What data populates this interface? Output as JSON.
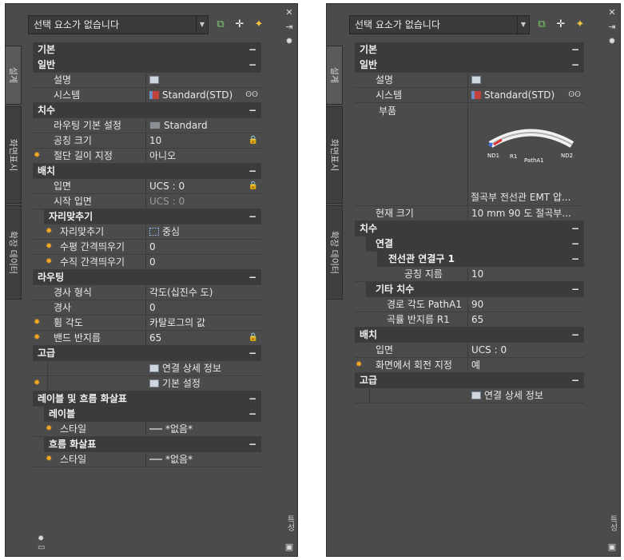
{
  "panel_left": {
    "selection": "선택 요소가 없습니다",
    "tabs": [
      "설계",
      "화면표시",
      "확장 데이터"
    ],
    "side_text": "특성",
    "sections": {
      "basic": "기본",
      "general": "일반",
      "desc_name": "설명",
      "system_name": "시스템",
      "system_val": "Standard(STD)",
      "dimensions": "치수",
      "routing_pref_name": "라우팅 기본 설정",
      "routing_pref_val": "Standard",
      "nominal_name": "공칭 크기",
      "nominal_val": "10",
      "cutlen_name": "절단 길이 지정",
      "cutlen_val": "아니오",
      "placement": "배치",
      "elev_name": "입면",
      "elev_val": "UCS : 0",
      "startelev_name": "시작 입면",
      "startelev_val": "UCS : 0",
      "justify": "자리맞추기",
      "justify_name": "자리맞추기",
      "justify_val": "중심",
      "hoff_name": "수평 간격띄우기",
      "hoff_val": "0",
      "voff_name": "수직 간격띄우기",
      "voff_val": "0",
      "routing": "라우팅",
      "slope_fmt_name": "경사 형식",
      "slope_fmt_val": "각도(십진수 도)",
      "slope_name": "경사",
      "slope_val": "0",
      "bend_angle_name": "휨 각도",
      "bend_angle_val": "카탈로그의 값",
      "bend_radius_name": "밴드 반지름",
      "bend_radius_val": "65",
      "advanced": "고급",
      "conn_detail": "연결 상세 정보",
      "base_settings": "기본 설정",
      "labels_flow": "레이블 및 흐름 화살표",
      "label": "레이블",
      "style_name": "스타일",
      "style_val": "*없음*",
      "flow": "흐름 화살표",
      "flow_style_name": "스타일",
      "flow_style_val": "*없음*"
    }
  },
  "panel_right": {
    "selection": "선택 요소가 없습니다",
    "tabs": [
      "설계",
      "화면표시",
      "확장 데이터"
    ],
    "side_text": "특성",
    "sections": {
      "basic": "기본",
      "general": "일반",
      "desc_name": "설명",
      "system_name": "시스템",
      "system_val": "Standard(STD)",
      "part_name": "부품",
      "part_caption": "절곡부 전선관 EMT 압...",
      "preview_labels": [
        "ND1",
        "R1",
        "PathA1",
        "ND2"
      ],
      "cursize_name": "현재 크기",
      "cursize_val": "10 mm 90 도 절곡부...",
      "dimensions": "치수",
      "connection": "연결",
      "conduit_conn": "전선관 연결구 1",
      "nom_dia_name": "공칭 지름",
      "nom_dia_val": "10",
      "other_dims": "기타 치수",
      "path_angle_name": "경로 각도 PathA1",
      "path_angle_val": "90",
      "bend_radius_name": "곡률 반지름 R1",
      "bend_radius_val": "65",
      "placement": "배치",
      "elev_name": "입면",
      "elev_val": "UCS : 0",
      "rot_name": "화면에서 회전 지정",
      "rot_val": "예",
      "advanced": "고급",
      "conn_detail": "연결 상세 정보"
    }
  }
}
